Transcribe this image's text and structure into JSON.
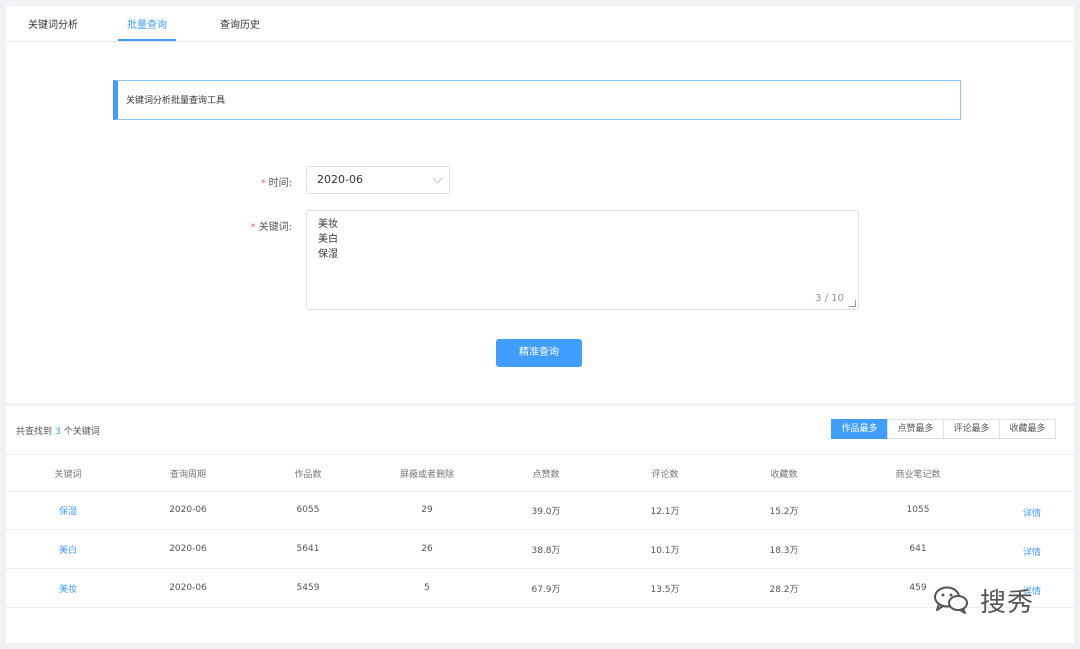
{
  "tabs": [
    {
      "label": "关键词分析"
    },
    {
      "label": "批量查询"
    },
    {
      "label": "查询历史"
    }
  ],
  "notice": "关键词分析批量查询工具",
  "form": {
    "time_label": "时间:",
    "time_value": "2020-06",
    "keyword_label": "关键词:",
    "keywords": [
      "美妆",
      "美白",
      "保湿"
    ],
    "keyword_count": "3 / 10",
    "search_button": "精准查询"
  },
  "results": {
    "found_prefix": "共查找到",
    "found_count": "3",
    "found_suffix": "个关键词",
    "sort_buttons": [
      {
        "label": "作品最多"
      },
      {
        "label": "点赞最多"
      },
      {
        "label": "评论最多"
      },
      {
        "label": "收藏最多"
      }
    ],
    "columns": [
      "关键词",
      "查询周期",
      "作品数",
      "屏蔽或者删除",
      "点赞数",
      "评论数",
      "收藏数",
      "商业笔记数"
    ],
    "rows": [
      {
        "keyword": "保湿",
        "period": "2020-06",
        "works": "6055",
        "blocked": "29",
        "likes": "39.0万",
        "comments": "12.1万",
        "favorites": "15.2万",
        "commercial": "1055",
        "action": "详情"
      },
      {
        "keyword": "美白",
        "period": "2020-06",
        "works": "5641",
        "blocked": "26",
        "likes": "38.8万",
        "comments": "10.1万",
        "favorites": "18.3万",
        "commercial": "641",
        "action": "详情"
      },
      {
        "keyword": "美妆",
        "period": "2020-06",
        "works": "5459",
        "blocked": "5",
        "likes": "67.9万",
        "comments": "13.5万",
        "favorites": "28.2万",
        "commercial": "459",
        "action": "详情"
      }
    ]
  },
  "watermark": "搜秀",
  "colors": {
    "primary": "#409eff",
    "required": "#f56c6c",
    "background": "#f0f2f5"
  }
}
